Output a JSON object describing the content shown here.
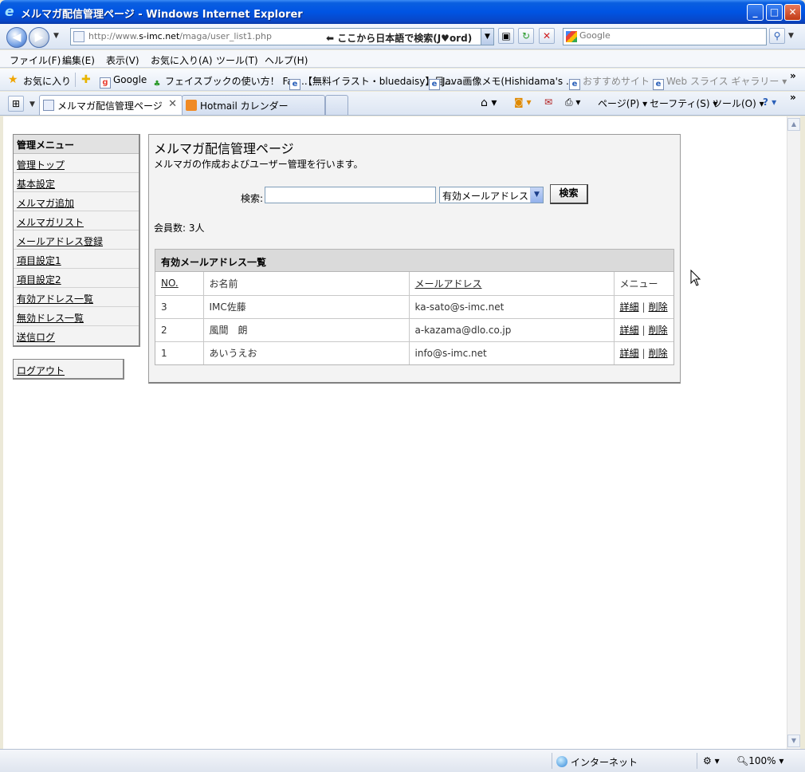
{
  "window": {
    "title": "メルマガ配信管理ページ - Windows Internet Explorer",
    "minimize": "_",
    "maximize": "□",
    "close": "✕"
  },
  "nav": {
    "url_prefix": "http://www.",
    "url_domain": "s-imc.net",
    "url_path": "/maga/user_list1.php",
    "address_hint": "⬅ ここから日本語で検索(J♥ord)",
    "search_placeholder": "Google"
  },
  "menubar": [
    "ファイル(F)",
    "編集(E)",
    "表示(V)",
    "お気に入り(A)",
    "ツール(T)",
    "ヘルプ(H)"
  ],
  "favorites": {
    "label": "お気に入り",
    "items": [
      {
        "label": "Google",
        "dim": false
      },
      {
        "label": "フェイスブックの使い方！ Fac...",
        "dim": false
      },
      {
        "label": "【無料イラスト・bluedaisy】目...",
        "dim": false
      },
      {
        "label": "Java画像メモ(Hishidama's ...",
        "dim": false
      },
      {
        "label": "おすすめサイト ▾",
        "dim": true
      },
      {
        "label": "Web スライス ギャラリー ▾",
        "dim": true
      }
    ],
    "more": "»"
  },
  "tabs": [
    {
      "label": "メルマガ配信管理ページ",
      "active": true
    },
    {
      "label": "Hotmail カレンダー",
      "active": false
    }
  ],
  "commandbar": {
    "page": "ページ(P) ▾",
    "safety": "セーフティ(S) ▾",
    "tools": "ツール(O) ▾",
    "help": "? ▾",
    "more": "»"
  },
  "sidebar": {
    "header": "管理メニュー",
    "items": [
      "管理トップ",
      "基本設定",
      "メルマガ追加",
      "メルマガリスト",
      "メールアドレス登録",
      "項目設定1",
      "項目設定2",
      "有効アドレス一覧",
      "無効ドレス一覧",
      "送信ログ"
    ],
    "logout": "ログアウト"
  },
  "main": {
    "title": "メルマガ配信管理ページ",
    "description": "メルマガの作成およびユーザー管理を行います。",
    "search_label": "検索:",
    "search_value": "",
    "filter_selected": "有効メールアドレス",
    "search_button": "検索",
    "member_count": "会員数: 3人"
  },
  "list": {
    "title": "有効メールアドレス一覧",
    "columns": {
      "no": "NO.",
      "name": "お名前",
      "email": "メールアドレス",
      "menu": "メニュー"
    },
    "rows": [
      {
        "no": "3",
        "name": "IMC佐藤",
        "email": "ka-sato@s-imc.net",
        "detail": "詳細",
        "delete": "削除"
      },
      {
        "no": "2",
        "name": "風間　朗",
        "email": "a-kazama@dlo.co.jp",
        "detail": "詳細",
        "delete": "削除"
      },
      {
        "no": "1",
        "name": "あいうえお",
        "email": "info@s-imc.net",
        "detail": "詳細",
        "delete": "削除"
      }
    ]
  },
  "status": {
    "zone": "インターネット",
    "zoom": "100%"
  }
}
